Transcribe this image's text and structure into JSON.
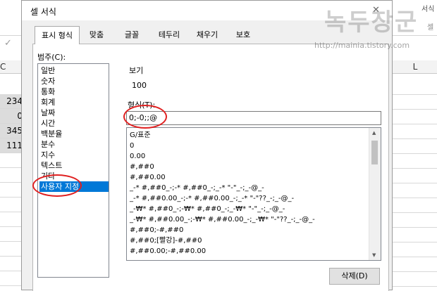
{
  "sheet": {
    "col_c": "C",
    "col_l": "L",
    "cells": [
      "234",
      "0",
      "345",
      "111"
    ],
    "right_stub": "서식",
    "right_stub2": "셀"
  },
  "dialog": {
    "title": "셀 서식",
    "tabs": [
      "표시 형식",
      "맞춤",
      "글꼴",
      "테두리",
      "채우기",
      "보호"
    ],
    "category_label": "범주(C):",
    "categories": [
      "일반",
      "숫자",
      "통화",
      "회계",
      "날짜",
      "시간",
      "백분율",
      "분수",
      "지수",
      "텍스트",
      "기타",
      "사용자 지정"
    ],
    "selected_category": "사용자 지정",
    "sample_label": "보기",
    "sample_value": "100",
    "type_label": "형식(T):",
    "type_value": "0;-0;;@",
    "format_list": [
      "G/표준",
      "0",
      "0.00",
      "#,##0",
      "#,##0.00",
      "_-* #,##0_-;-* #,##0_-;_-* \"-\"_-;_-@_-",
      "_-* #,##0.00_-;-* #,##0.00_-;_-* \"-\"??_-;_-@_-",
      "_-₩* #,##0_-;-₩* #,##0_-;_-₩* \"-\"_-;_-@_-",
      "_-₩* #,##0.00_-;-₩* #,##0.00_-;_-₩* \"-\"??_-;_-@_-",
      "#,##0;-#,##0",
      "#,##0;[빨강]-#,##0",
      "#,##0.00;-#,##0.00"
    ],
    "delete_label": "삭제(D)"
  },
  "watermark": {
    "title": "녹두장군",
    "url": "http://mainia.tistory.com"
  },
  "colors": {
    "accent": "#0078d7",
    "highlight_circle": "#e02020"
  }
}
